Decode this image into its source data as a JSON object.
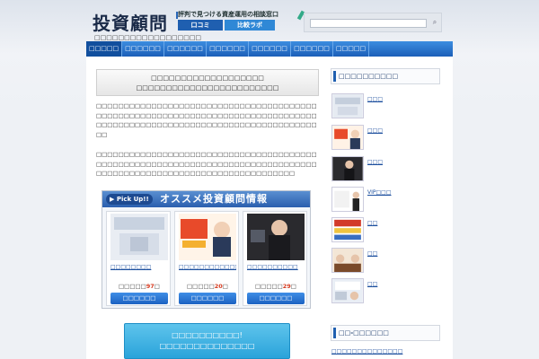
{
  "header": {
    "logo_main": "投資顧問",
    "logo_tag": "評判で見つける資産運用の相談窓口",
    "logo_box1": "口コミ",
    "logo_box2": "比較ラボ",
    "sub": "□□□□□□□□□□□□□□□□□□",
    "search_placeholder": ""
  },
  "nav": {
    "items": [
      {
        "label": "□□□□□",
        "active": true
      },
      {
        "label": "□□□□□□"
      },
      {
        "label": "□□□□□□"
      },
      {
        "label": "□□□□□□"
      },
      {
        "label": "□□□□□□"
      },
      {
        "label": "□□□□□□"
      },
      {
        "label": "□□□□□"
      }
    ]
  },
  "main": {
    "title_line1": "□□□□□□□□□□□□□□□□□□□",
    "title_line2": "□□□□□□□□□□□□□□□□□□□□□□□□",
    "para1": "□□□□□□□□□□□□□□□□□□□□□□□□□□□□□□□□□□□□□□□□□□□□□□□□□□□□□□□□□□□□□□□□□□□□□□□□□□□□□□□□□□□□□□□□□□□□□□□□□□□□□□□□□□□□□□□□□□□□□□□□□□",
    "para2": "□□□□□□□□□□□□□□□□□□□□□□□□□□□□□□□□□□□□□□□□□□□□□□□□□□□□□□□□□□□□□□□□□□□□□□□□□□□□□□□□□□□□□□□□□□□□□□□□□□□□□□□□□□□□□□□□□□□□"
  },
  "pickup": {
    "label": "▶ Pick Up!!",
    "title": "オススメ投資顧問情報",
    "cards": [
      {
        "name": "□□□□□□□□",
        "rating_prefix": "□□□□□",
        "rating_num": "97",
        "rating_suffix": "□",
        "button": "□□□□□□"
      },
      {
        "name": "□□□□□□□□□□□□",
        "rating_prefix": "□□□□□",
        "rating_num": "20",
        "rating_suffix": "□",
        "button": "□□□□□□"
      },
      {
        "name": "□□□□□□□□□□",
        "rating_prefix": "□□□□□",
        "rating_num": "29",
        "rating_suffix": "□",
        "button": "□□□□□□"
      }
    ]
  },
  "cta": {
    "line1": "□□□□□□□□□□!",
    "line2": "□□□□□□□□□□□□□□"
  },
  "sidebar": {
    "head1": "□□□□□□□□□□",
    "items": [
      {
        "label": "□□□"
      },
      {
        "label": "□□□"
      },
      {
        "label": "□□□"
      },
      {
        "label": "VIP□□□"
      },
      {
        "label": "□□"
      },
      {
        "label": "□□"
      },
      {
        "label": "□□"
      },
      {
        "label": "□□"
      }
    ],
    "head2": "□□-□□□□□□",
    "list_item": "□□□□□□□□□□□□□□"
  }
}
